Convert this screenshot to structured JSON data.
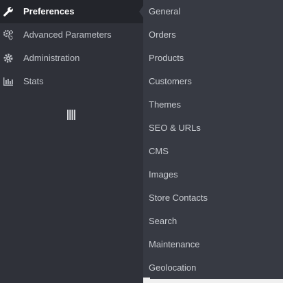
{
  "sidebar": {
    "items": [
      {
        "label": "Preferences",
        "icon": "wrench-icon"
      },
      {
        "label": "Advanced Parameters",
        "icon": "gears-icon"
      },
      {
        "label": "Administration",
        "icon": "gear-icon"
      },
      {
        "label": "Stats",
        "icon": "bar-chart-icon"
      }
    ],
    "collapse_toggle_icon": "vertical-bars-icon"
  },
  "submenu": {
    "items": [
      "General",
      "Orders",
      "Products",
      "Customers",
      "Themes",
      "SEO & URLs",
      "CMS",
      "Images",
      "Store Contacts",
      "Search",
      "Maintenance",
      "Geolocation"
    ]
  },
  "colors": {
    "sidebar_bg": "#2f3139",
    "active_bg": "#23252b",
    "submenu_bg": "#373a43",
    "text": "#bfc2c8",
    "active_text": "#ffffff"
  }
}
